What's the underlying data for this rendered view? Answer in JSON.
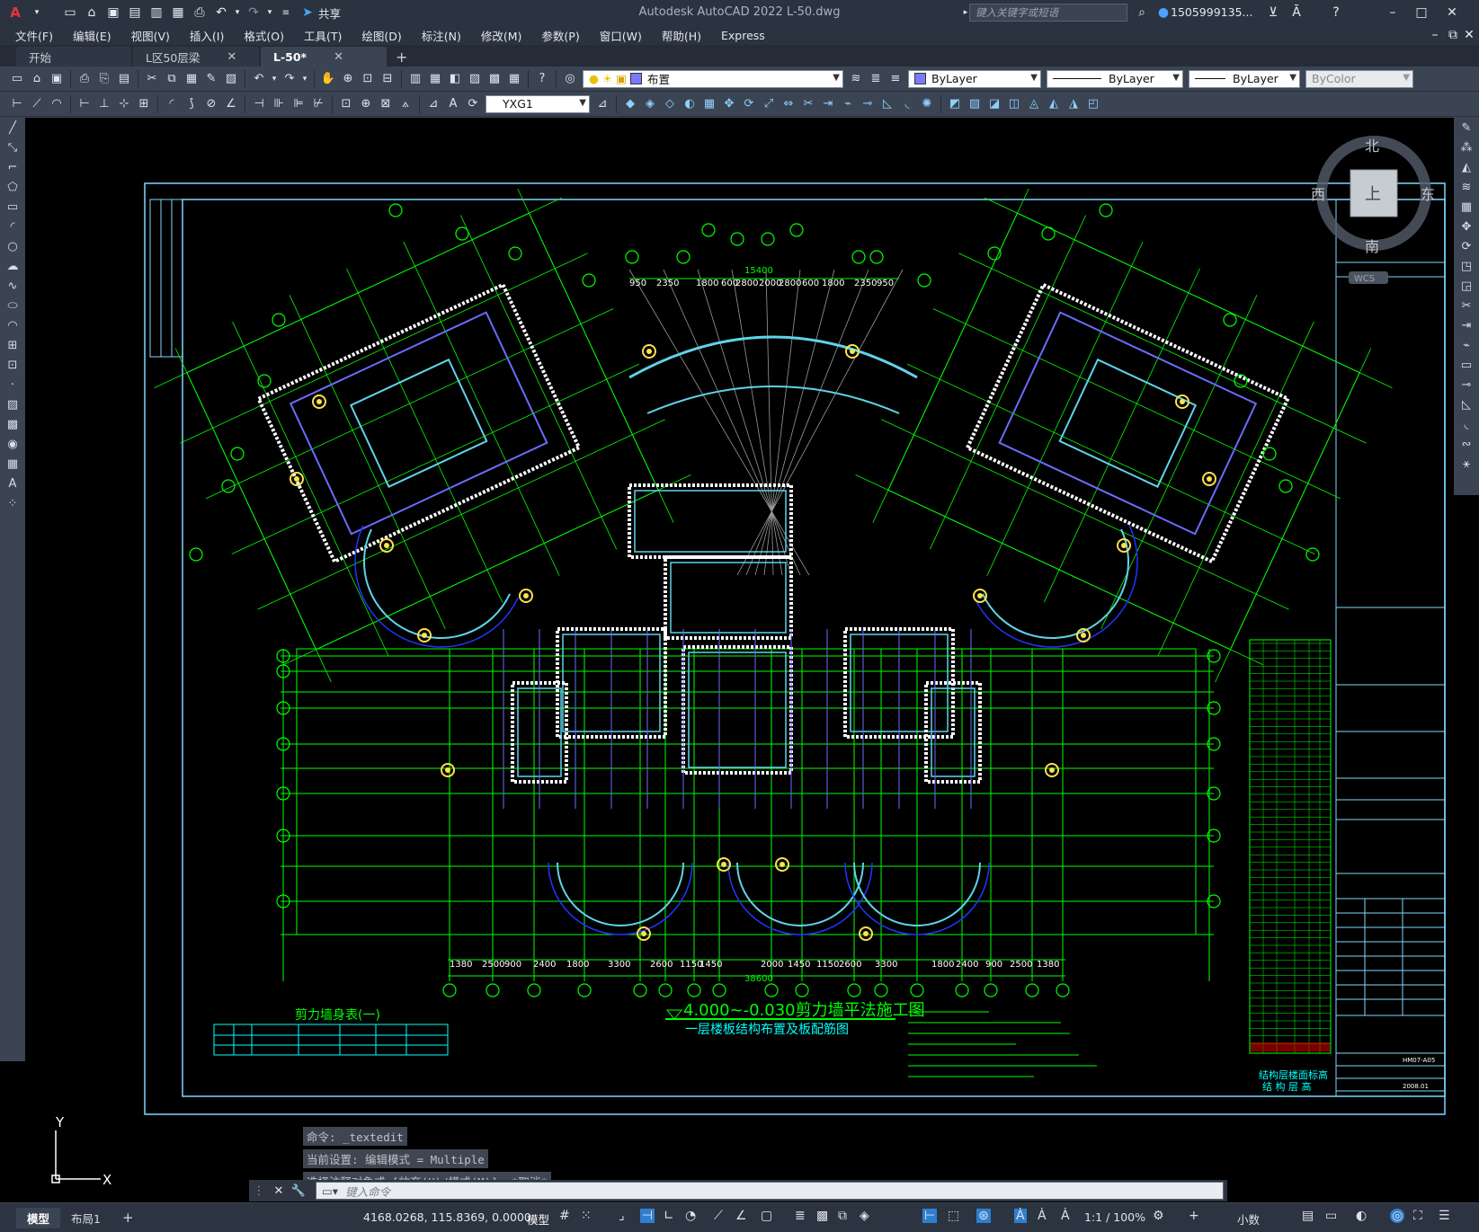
{
  "titlebar": {
    "app_title": "Autodesk AutoCAD 2022    L-50.dwg",
    "share_label": "共享",
    "search_placeholder": "键入关键字或短语",
    "user_name": "1505999135..."
  },
  "menu": [
    "文件(F)",
    "编辑(E)",
    "视图(V)",
    "插入(I)",
    "格式(O)",
    "工具(T)",
    "绘图(D)",
    "标注(N)",
    "修改(M)",
    "参数(P)",
    "窗口(W)",
    "帮助(H)",
    "Express"
  ],
  "tabs": [
    {
      "label": "开始"
    },
    {
      "label": "L区50层梁"
    },
    {
      "label": "L-50*"
    }
  ],
  "toolbar": {
    "layer_name": "布置",
    "color": "ByLayer",
    "linetype": "ByLayer",
    "lineweight": "ByLayer",
    "plotstyle": "ByColor",
    "dimstyle": "YXG1"
  },
  "viewcube": {
    "north": "北",
    "south": "南",
    "east": "东",
    "west": "西",
    "face": "上",
    "wcs": "WCS"
  },
  "drawing": {
    "title_main": "4.000~-0.030剪力墙平法施工图",
    "title_sub": "一层楼板结构布置及板配筋图",
    "wall_table_title": "剪力墙身表(一)",
    "story_table_title": "结构层楼面标高",
    "story_table_sub": "结 构 层 高",
    "dim_bottom_total": "38600",
    "dims_bottom": [
      "1380",
      "2500",
      "900",
      "2400",
      "1800",
      "3300",
      "2600",
      "1150",
      "1450",
      "2000",
      "1450",
      "1150",
      "2600",
      "3300",
      "1800",
      "2400",
      "900",
      "2500",
      "1380"
    ],
    "dims_top": [
      "950",
      "2350",
      "1800",
      "600",
      "2800",
      "2000",
      "2800",
      "600",
      "1800",
      "2350",
      "950"
    ],
    "dim_top_total": "15400",
    "title_block_date": "2008.01",
    "title_block_no": "HM07-A05"
  },
  "command": {
    "history": [
      "命令: _textedit",
      "当前设置: 编辑模式 = Multiple",
      "选择注释对象或 [放弃(U)/模式(M)]: *取消*"
    ],
    "placeholder": "键入命令"
  },
  "status": {
    "tab_model": "模型",
    "tab_layout": "布局1",
    "coords": "4168.0268, 115.8369, 0.0000",
    "space": "模型",
    "scale": "1:1 / 100%",
    "units": "小数"
  },
  "colors": {
    "canvas": "#000000",
    "grid_green": "#00ff00",
    "walls_cyan": "#5fd3e8",
    "blue_lines": "#6b6bff",
    "frame": "#7fd7ff"
  }
}
